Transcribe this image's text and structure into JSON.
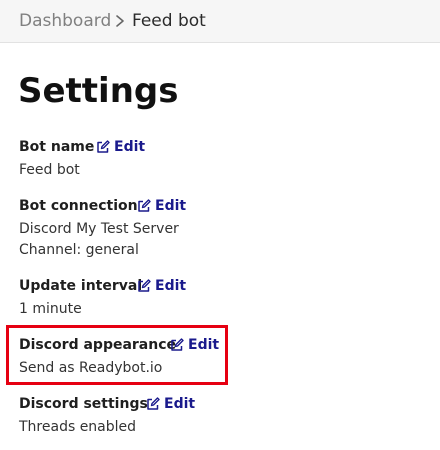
{
  "breadcrumb": {
    "parent": "Dashboard",
    "current": "Feed bot"
  },
  "page": {
    "title": "Settings"
  },
  "settings": {
    "bot_name": {
      "label": "Bot name",
      "edit": "Edit",
      "value": "Feed bot"
    },
    "bot_connection": {
      "label": "Bot connection",
      "edit": "Edit",
      "value": "Discord My Test Server",
      "value2": "Channel: general"
    },
    "update_interval": {
      "label": "Update interval",
      "edit": "Edit",
      "value": "1 minute"
    },
    "discord_appearance": {
      "label": "Discord appearance",
      "edit": "Edit",
      "value": "Send as Readybot.io"
    },
    "discord_settings": {
      "label": "Discord settings",
      "edit": "Edit",
      "value": "Threads enabled"
    }
  },
  "icons": {
    "edit": "edit-icon",
    "breadcrumb_separator": "chevron-right-icon"
  },
  "colors": {
    "link": "#1a1a8c",
    "highlight": "#e60012"
  }
}
